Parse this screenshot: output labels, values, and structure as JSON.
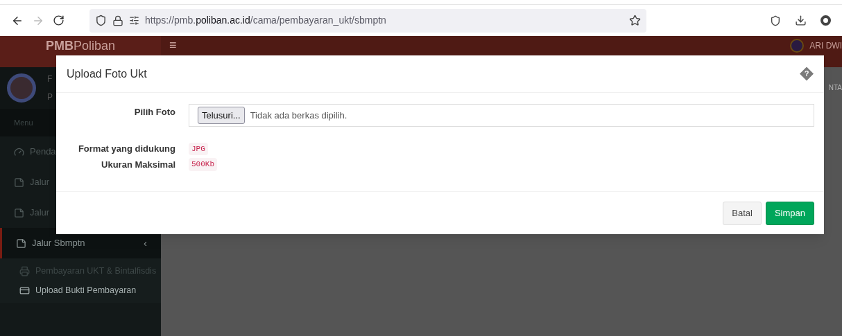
{
  "browser": {
    "back_enabled": true,
    "forward_enabled": false,
    "url": {
      "prefix": "https://pmb.",
      "domain": "poliban.ac.id",
      "path": "/cama/pembayaran_ukt/sbmptn"
    }
  },
  "header": {
    "brand_bold": "PMB",
    "brand_rest": "Poliban",
    "menu_toggle": "≡",
    "user": "ARI DWI"
  },
  "sidebar": {
    "profile_initials": [
      "F",
      "P"
    ],
    "section": "Menu",
    "items": [
      {
        "label": "Penda",
        "kind": "dashboard",
        "selected": false
      },
      {
        "label": "Jalur",
        "kind": "note",
        "selected": false
      },
      {
        "label": "Jalur",
        "kind": "note",
        "selected": false
      },
      {
        "label": "Jalur Sbmptn",
        "kind": "note",
        "selected": true,
        "expanded": true,
        "caret": "‹",
        "children": [
          {
            "label": "Pembayaran UKT & Bintalfisdis",
            "kind": "print",
            "selected": false
          },
          {
            "label": "Upload Bukti Pembayaran",
            "kind": "card",
            "selected": true
          }
        ]
      }
    ]
  },
  "content": {
    "tab_fragment": "NTA"
  },
  "modal": {
    "title": "Upload Foto Ukt",
    "help": "?",
    "file_field": {
      "label": "Pilih Foto",
      "button": "Telusuri...",
      "status": "Tidak ada berkas dipilih."
    },
    "info": [
      {
        "label": "Format yang didukung",
        "value": "JPG"
      },
      {
        "label": "Ukuran Maksimal",
        "value": "500Kb"
      }
    ],
    "buttons": [
      {
        "label": "Batal",
        "kind": "secondary"
      },
      {
        "label": "Simpan",
        "kind": "primary"
      }
    ]
  }
}
